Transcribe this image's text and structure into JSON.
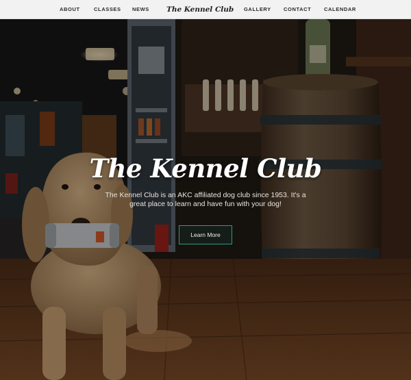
{
  "nav": {
    "left_links": [
      "ABOUT",
      "CLASSES",
      "NEWS"
    ],
    "brand": "The Kennel Club",
    "right_links": [
      "GALLERY",
      "CONTACT",
      "CALENDAR"
    ]
  },
  "hero": {
    "title": "The Kennel Club",
    "description": "The Kennel Club is an AKC affiliated dog club since 1953. It's a great place to learn and have fun with your dog!",
    "button_label": "Learn More",
    "button_border_color": "#2f9a84"
  },
  "colors": {
    "navbar_bg": "#f2f2f2",
    "nav_text": "#2a2a2a",
    "title_text": "#ffffff"
  }
}
